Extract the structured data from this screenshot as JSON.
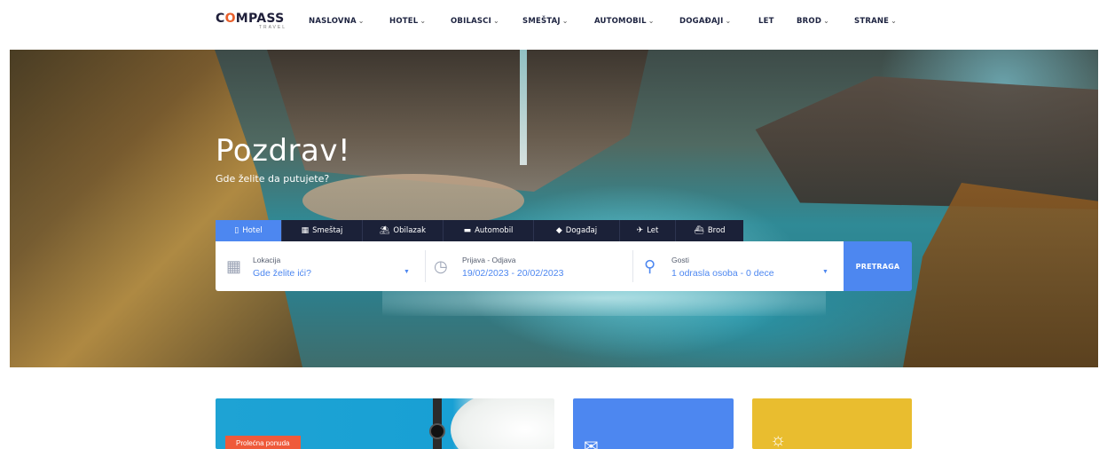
{
  "brand": {
    "logo_text": "COMPASS",
    "logo_sub": "TRAVEL"
  },
  "nav": {
    "items": [
      {
        "label": "NASLOVNA",
        "dropdown": true
      },
      {
        "label": "HOTEL",
        "dropdown": true
      },
      {
        "label": "OBILASCI",
        "dropdown": true
      },
      {
        "label": "SMEŠTAJ",
        "dropdown": true
      },
      {
        "label": "AUTOMOBIL",
        "dropdown": true
      },
      {
        "label": "DOGAĐAJI",
        "dropdown": true
      },
      {
        "label": "LET",
        "dropdown": false
      },
      {
        "label": "BROD",
        "dropdown": true
      },
      {
        "label": "STRANE",
        "dropdown": true
      }
    ],
    "chevron": "⌄"
  },
  "hero": {
    "title": "Pozdrav!",
    "subtitle": "Gde želite da putujete?"
  },
  "search_tabs": [
    {
      "label": "Hotel",
      "icon": "hotel-icon",
      "active": true
    },
    {
      "label": "Smeštaj",
      "icon": "apartment-icon",
      "active": false
    },
    {
      "label": "Obilazak",
      "icon": "tour-icon",
      "active": false
    },
    {
      "label": "Automobil",
      "icon": "car-icon",
      "active": false
    },
    {
      "label": "Događaj",
      "icon": "event-icon",
      "active": false
    },
    {
      "label": "Let",
      "icon": "plane-icon",
      "active": false
    },
    {
      "label": "Brod",
      "icon": "ship-icon",
      "active": false
    }
  ],
  "search": {
    "location": {
      "label": "Lokacija",
      "placeholder": "Gde želite ići?"
    },
    "dates": {
      "label": "Prijava - Odjava",
      "value": "19/02/2023 - 20/02/2023"
    },
    "guests": {
      "label": "Gosti",
      "value": "1 odrasla osoba - 0 dece"
    },
    "submit_label": "PRETRAGA"
  },
  "promo_cards": [
    {
      "badge": "Prolećna ponuda"
    }
  ],
  "colors": {
    "accent": "#4d87f0",
    "tabbar": "#1b2138",
    "badge": "#ef5a3a",
    "card_yellow": "#e9bd2f",
    "card_cyan": "#1ea3d4"
  }
}
